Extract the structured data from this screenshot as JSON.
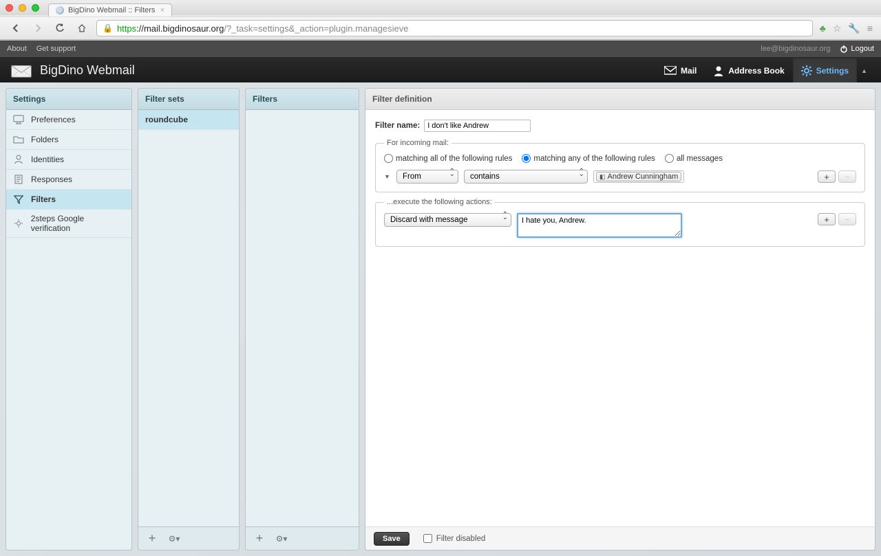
{
  "browser": {
    "tab_title": "BigDino Webmail :: Filters",
    "url_protocol": "https",
    "url_host": "://mail.bigdinosaur.org",
    "url_path": "/?_task=settings&_action=plugin.managesieve"
  },
  "top_strip": {
    "about": "About",
    "get_support": "Get support",
    "user_email": "lee@bigdinosaur.org",
    "logout": "Logout"
  },
  "header": {
    "app_title": "BigDino Webmail",
    "nav": {
      "mail": "Mail",
      "address_book": "Address Book",
      "settings": "Settings"
    }
  },
  "panels": {
    "settings": {
      "title": "Settings",
      "items": [
        {
          "label": "Preferences"
        },
        {
          "label": "Folders"
        },
        {
          "label": "Identities"
        },
        {
          "label": "Responses"
        },
        {
          "label": "Filters"
        },
        {
          "label": "2steps Google verification"
        }
      ]
    },
    "filter_sets": {
      "title": "Filter sets",
      "items": [
        "roundcube"
      ]
    },
    "filters": {
      "title": "Filters"
    },
    "definition": {
      "title": "Filter definition",
      "filter_name_label": "Filter name:",
      "filter_name_value": "I don't like Andrew",
      "incoming_legend": "For incoming mail:",
      "radio_all": "matching all of the following rules",
      "radio_any": "matching any of the following rules",
      "radio_msgs": "all messages",
      "rule_field": "From",
      "rule_op": "contains",
      "rule_value": "Andrew Cunningham",
      "actions_legend": "...execute the following actions:",
      "action_select": "Discard with message",
      "action_message": "I hate you, Andrew.",
      "save": "Save",
      "filter_disabled": "Filter disabled"
    }
  }
}
